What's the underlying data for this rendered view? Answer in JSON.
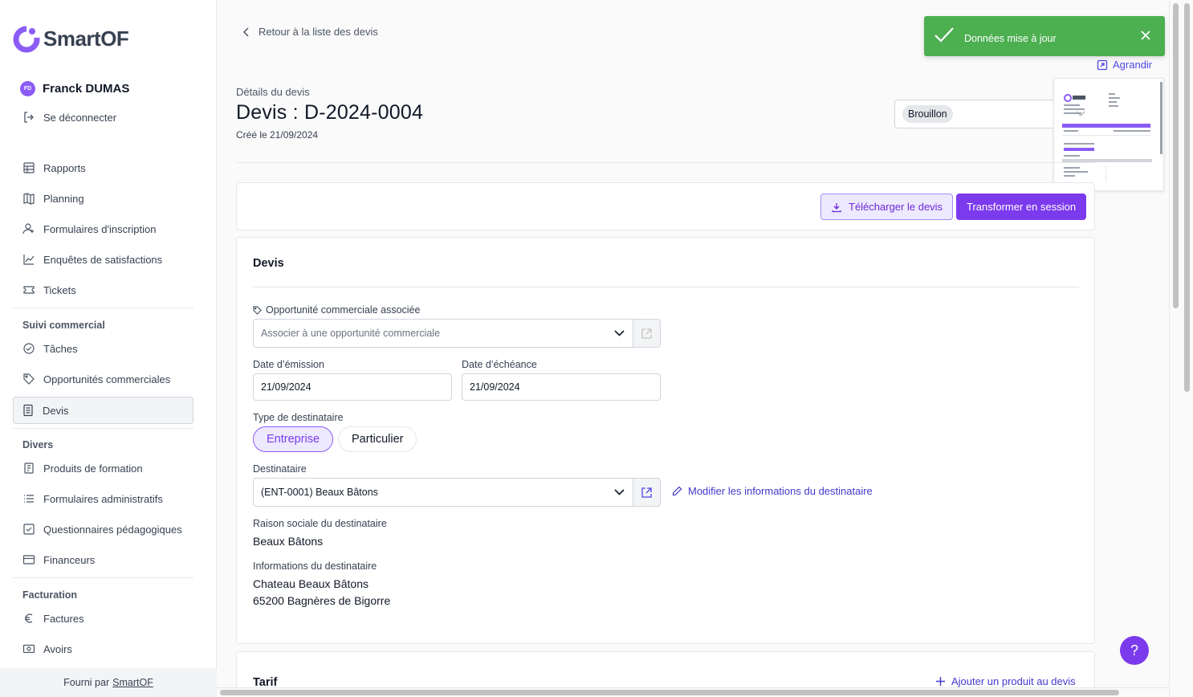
{
  "brand": {
    "name": "SmartOF",
    "accent": "#7c3aed"
  },
  "user": {
    "initials": "FD",
    "name": "Franck DUMAS",
    "logout_label": "Se déconnecter"
  },
  "sidebar": {
    "main_items": [
      {
        "label": "Rapports",
        "icon": "table-icon"
      },
      {
        "label": "Planning",
        "icon": "map-icon"
      },
      {
        "label": "Formulaires d'inscription",
        "icon": "user-plus-icon"
      },
      {
        "label": "Enquêtes de satisfactions",
        "icon": "chart-icon"
      },
      {
        "label": "Tickets",
        "icon": "ticket-icon"
      }
    ],
    "sections": [
      {
        "title": "Suivi commercial",
        "items": [
          {
            "label": "Tâches",
            "icon": "check-circle-icon"
          },
          {
            "label": "Opportunités commerciales",
            "icon": "tag-icon"
          },
          {
            "label": "Devis",
            "icon": "document-icon",
            "active": true
          }
        ]
      },
      {
        "title": "Divers",
        "items": [
          {
            "label": "Produits de formation",
            "icon": "book-icon"
          },
          {
            "label": "Formulaires administratifs",
            "icon": "list-icon"
          },
          {
            "label": "Questionnaires pédagogiques",
            "icon": "checkbox-icon"
          },
          {
            "label": "Financeurs",
            "icon": "card-icon"
          }
        ]
      },
      {
        "title": "Facturation",
        "items": [
          {
            "label": "Factures",
            "icon": "euro-icon"
          },
          {
            "label": "Avoirs",
            "icon": "banknote-icon"
          }
        ]
      }
    ],
    "footer": {
      "prefix": "Fourni par",
      "link": "SmartOF"
    }
  },
  "header": {
    "back_label": "Retour à la liste des devis",
    "subtitle": "Détails du devis",
    "title": "Devis : D-2024-0004",
    "created": "Créé le 21/09/2024",
    "status": "Brouillon",
    "expand_label": "Agrandir"
  },
  "actions": {
    "download_label": "Télécharger le devis",
    "transform_label": "Transformer en session"
  },
  "form": {
    "card_title": "Devis",
    "opportunity_label": "Opportunité commerciale associée",
    "opportunity_placeholder": "Associer à une opportunité commerciale",
    "issue_date_label": "Date d’émission",
    "issue_date": "21/09/2024",
    "due_date_label": "Date d’échéance",
    "due_date": "21/09/2024",
    "recipient_type_label": "Type de destinataire",
    "type_company": "Entreprise",
    "type_individual": "Particulier",
    "recipient_label": "Destinataire",
    "recipient_value": "(ENT-0001) Beaux Bâtons",
    "edit_recipient_label": "Modifier les informations du destinataire",
    "company_name_label": "Raison sociale du destinataire",
    "company_name": "Beaux Bâtons",
    "recipient_info_label": "Informations du destinataire",
    "recipient_info_line1": "Chateau Beaux Bâtons",
    "recipient_info_line2": "65200 Bagnères de Bigorre"
  },
  "tarif": {
    "title": "Tarif",
    "add_product_label": "Ajouter un produit au devis"
  },
  "toast": {
    "message": "Données mise à jour",
    "color": "#4caf50"
  },
  "help": {
    "label": "?"
  }
}
